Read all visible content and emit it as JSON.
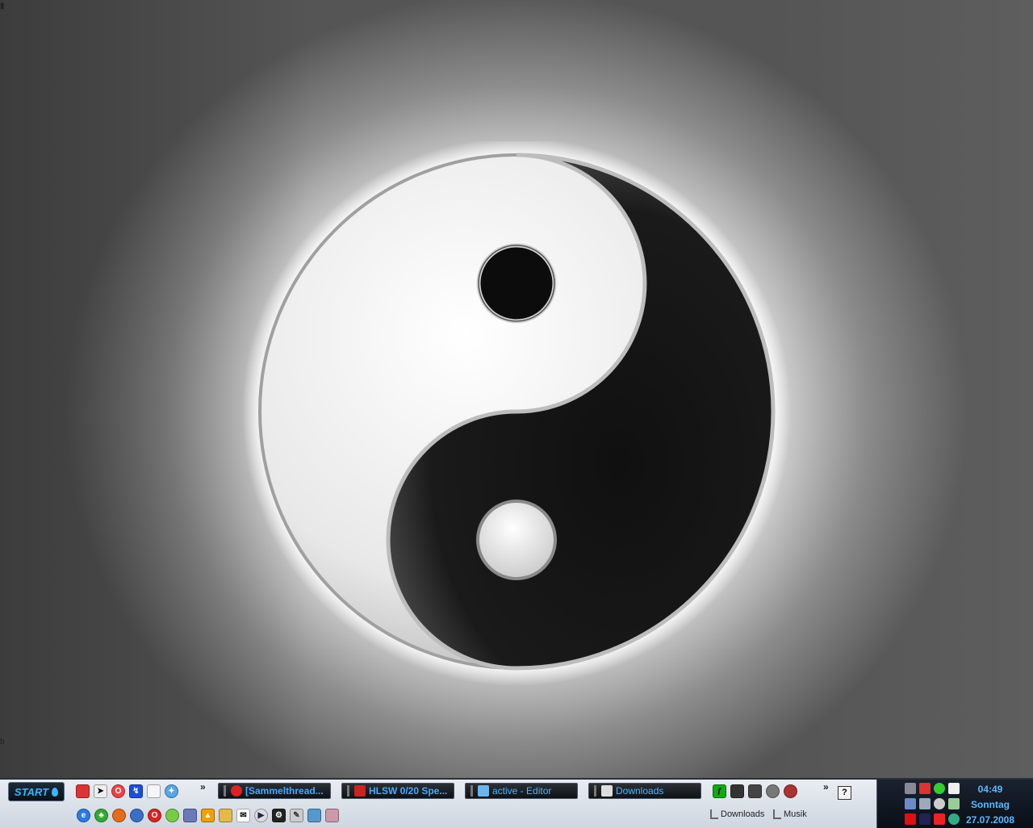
{
  "desktop": {
    "wallpaper": "yin-yang",
    "edge_glyph_top": "▮",
    "edge_glyph_bottom": "b"
  },
  "taskbar": {
    "start_label": "START",
    "overflow_chevron": "»",
    "quick_launch_top": [
      "app-red-icon",
      "cursor-icon",
      "opera-icon",
      "network-icon",
      "document-icon",
      "compass-icon"
    ],
    "quick_launch_bottom": [
      "internet-explorer-icon",
      "clover-icon",
      "firefox-icon",
      "thunderbird-icon",
      "opera-icon",
      "media-icon",
      "photo-icon",
      "vlc-icon",
      "tag-icon",
      "mail-icon",
      "media-player-icon",
      "steam-icon",
      "tool-icon",
      "messenger-icon",
      "archive-icon"
    ],
    "task_buttons": [
      {
        "label": "[Sammelthread...",
        "icon": "opera-icon"
      },
      {
        "label": "HLSW   0/20 Spe...",
        "icon": "hlsw-icon"
      },
      {
        "label": "active - Editor",
        "icon": "notepad-icon"
      },
      {
        "label": "Downloads",
        "icon": "folder-icon"
      }
    ],
    "folder_links": [
      {
        "label": "Downloads"
      },
      {
        "label": "Musik"
      }
    ],
    "help_label": "?",
    "colors": {
      "task_text": "#45aaff",
      "start_text": "#39b6ff"
    }
  },
  "tray": {
    "time": "04:49",
    "day": "Sonntag",
    "date": "27.07.2008",
    "icons": [
      "headset-icon",
      "app-red-icon",
      "clover-icon",
      "mail-icon",
      "network-icon",
      "people-icon",
      "satellite-icon",
      "arrow-icon",
      "ati-icon",
      "uac-icon",
      "antivirus-icon",
      "flag-icon"
    ]
  }
}
